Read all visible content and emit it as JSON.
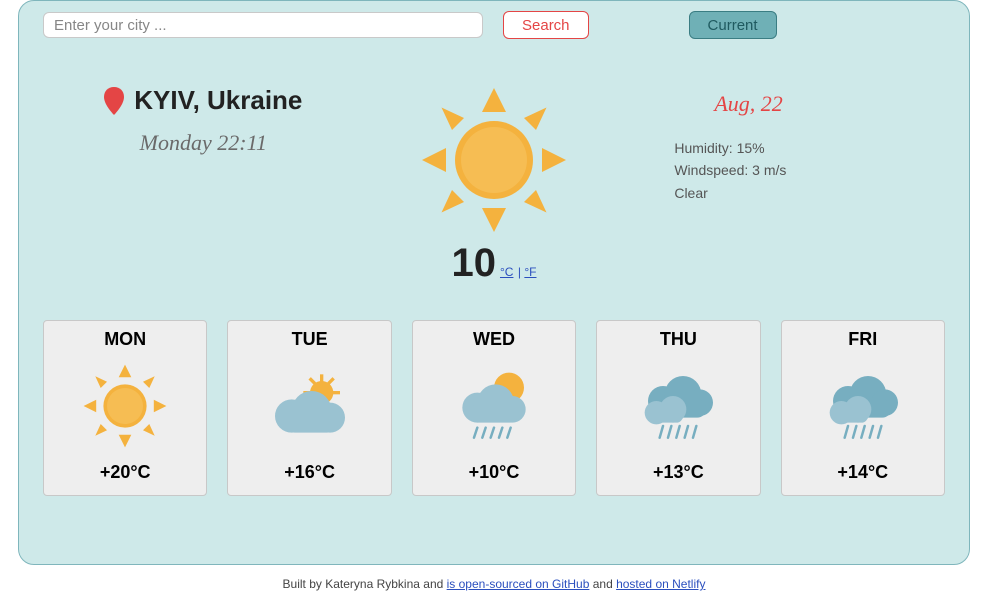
{
  "search": {
    "placeholder": "Enter your city ...",
    "search_label": "Search",
    "current_label": "Current"
  },
  "location": {
    "city_display": "KYIV, Ukraine",
    "datetime": "Monday 22:11"
  },
  "current": {
    "temperature_display": "10",
    "unit_c": "°C",
    "unit_sep": " | ",
    "unit_f": "°F",
    "date": "Aug, 22",
    "humidity_label": "Humidity: 15%",
    "wind_label": "Windspeed: 3 m/s",
    "condition": "Clear",
    "icon": "sun"
  },
  "forecast": {
    "days": [
      {
        "name": "MON",
        "temp": "+20°C",
        "icon": "sun"
      },
      {
        "name": "TUE",
        "temp": "+16°C",
        "icon": "partly"
      },
      {
        "name": "WED",
        "temp": "+10°C",
        "icon": "rain-sun"
      },
      {
        "name": "THU",
        "temp": "+13°C",
        "icon": "rain"
      },
      {
        "name": "FRI",
        "temp": "+14°C",
        "icon": "rain"
      }
    ]
  },
  "footer": {
    "prefix": "Built by Kateryna Rybkina and ",
    "link1": "is open-sourced on GitHub",
    "mid": " and ",
    "link2": "hosted on Netlify"
  },
  "colors": {
    "accent_red": "#e44545",
    "accent_teal": "#6fb0b6",
    "sun": "#f4b23e",
    "cloud": "#9ac2d1",
    "rain": "#77aec0"
  }
}
